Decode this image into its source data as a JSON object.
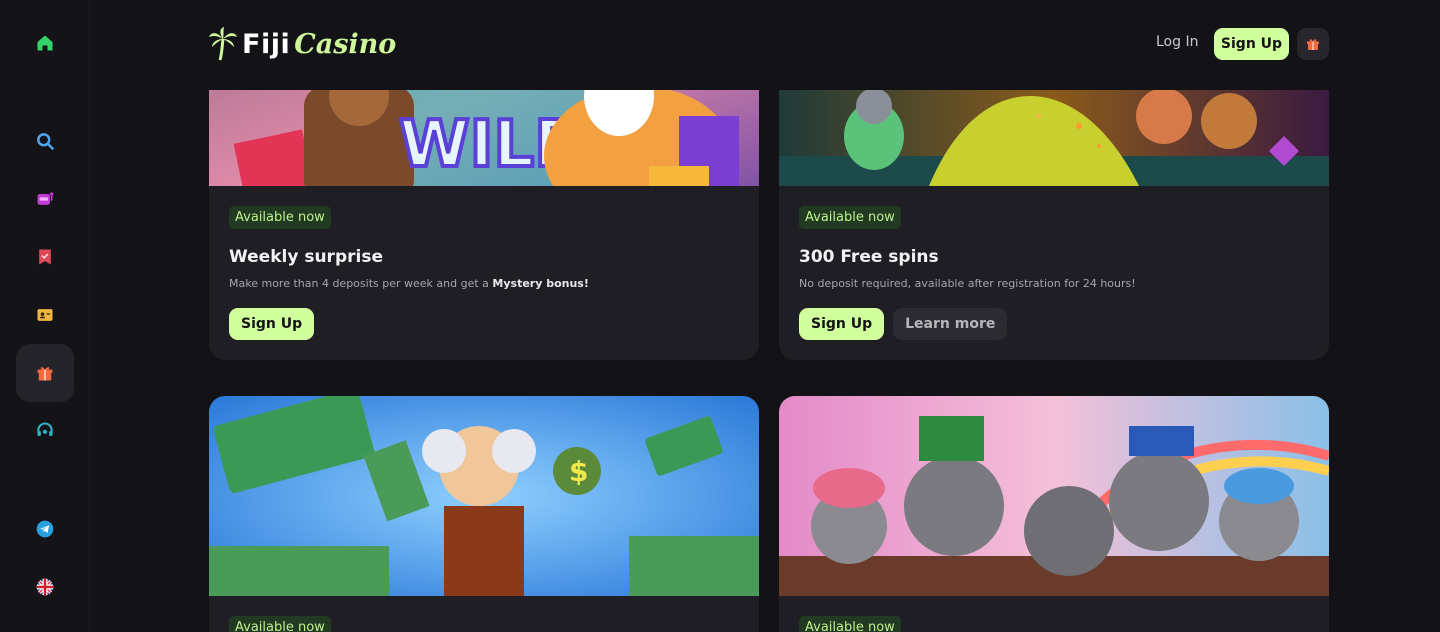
{
  "header": {
    "logo_main": "Fiji",
    "logo_accent": "Casino",
    "login_label": "Log In",
    "signup_label": "Sign Up"
  },
  "sidebar": {
    "items": [
      {
        "icon": "home-icon"
      },
      {
        "icon": "search-icon"
      },
      {
        "icon": "slot-machine-icon"
      },
      {
        "icon": "bookmark-icon"
      },
      {
        "icon": "id-card-icon"
      },
      {
        "icon": "gift-icon"
      },
      {
        "icon": "support-icon"
      },
      {
        "icon": "telegram-icon"
      },
      {
        "icon": "uk-flag-icon"
      }
    ]
  },
  "promos": [
    {
      "badge": "Available now",
      "title": "Weekly surprise",
      "desc_prefix": "Make more than 4 deposits per week and get a ",
      "desc_bold": "Mystery bonus!",
      "primary": "Sign Up"
    },
    {
      "badge": "Available now",
      "title": "300 Free spins",
      "desc_prefix": "No deposit required, available after registration for 24 hours!",
      "desc_bold": "",
      "primary": "Sign Up",
      "secondary": "Learn more"
    },
    {
      "badge": "Available now"
    },
    {
      "badge": "Available now"
    }
  ],
  "colors": {
    "background": "#131217",
    "card": "#1f1e24",
    "accent_green": "#d2ff9e",
    "badge_bg": "#223a22",
    "badge_text": "#bff08d"
  }
}
